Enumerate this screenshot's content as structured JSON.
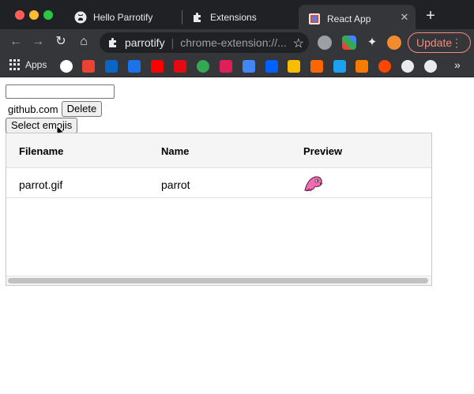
{
  "browser": {
    "tabs": [
      {
        "title": "Hello Parrotify",
        "icon": "github-icon"
      },
      {
        "title": "Extensions",
        "icon": "puzzle-icon"
      },
      {
        "title": "React App",
        "icon": "react-app-icon",
        "active": true
      }
    ],
    "new_tab_label": "+",
    "close_label": "✕",
    "omnibox": {
      "site": "parrotify",
      "url": "chrome-extension://..."
    },
    "update_label": "Update",
    "bookmarks_apps_label": "Apps",
    "bookmarks_more": "»",
    "colors": {
      "update": "#f28b82",
      "frame": "#202124",
      "toolbar": "#35363a"
    }
  },
  "page": {
    "input_value": "",
    "domain": "github.com",
    "delete_label": "Delete",
    "select_label": "Select emojis",
    "table": {
      "columns": [
        "Filename",
        "Name",
        "Preview"
      ],
      "rows": [
        {
          "filename": "parrot.gif",
          "name": "parrot",
          "preview": "parrot-emoji"
        }
      ]
    }
  }
}
